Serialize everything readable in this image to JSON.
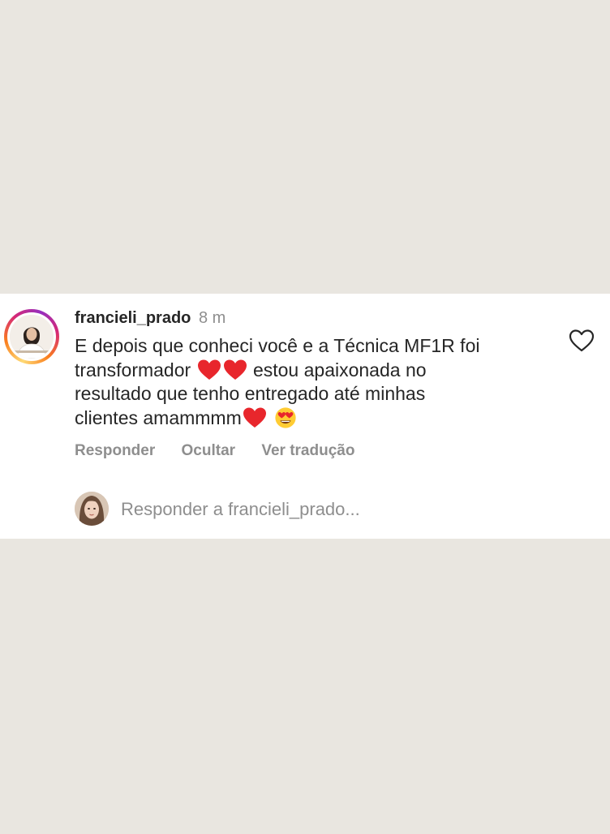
{
  "comment": {
    "username": "francieli_prado",
    "timestamp": "8 m",
    "text_line1": "E depois que conheci você e a Técnica MF1R foi",
    "text_line2_a": "transformador",
    "text_line2_b": "estou apaixonada no",
    "text_line3": "resultado que tenho entregado até minhas",
    "text_line4": "clientes amammmm",
    "like_icon": "heart-outline-icon",
    "emojis": [
      "red-heart",
      "red-heart",
      "red-heart",
      "heart-eyes-face"
    ]
  },
  "actions": {
    "reply": "Responder",
    "hide": "Ocultar",
    "translate": "Ver tradução"
  },
  "reply_box": {
    "placeholder": "Responder a francieli_prado..."
  },
  "colors": {
    "background": "#e9e6e0",
    "card": "#ffffff",
    "text": "#262626",
    "muted": "#8e8e8e",
    "heart_emoji": "#e8262c"
  }
}
